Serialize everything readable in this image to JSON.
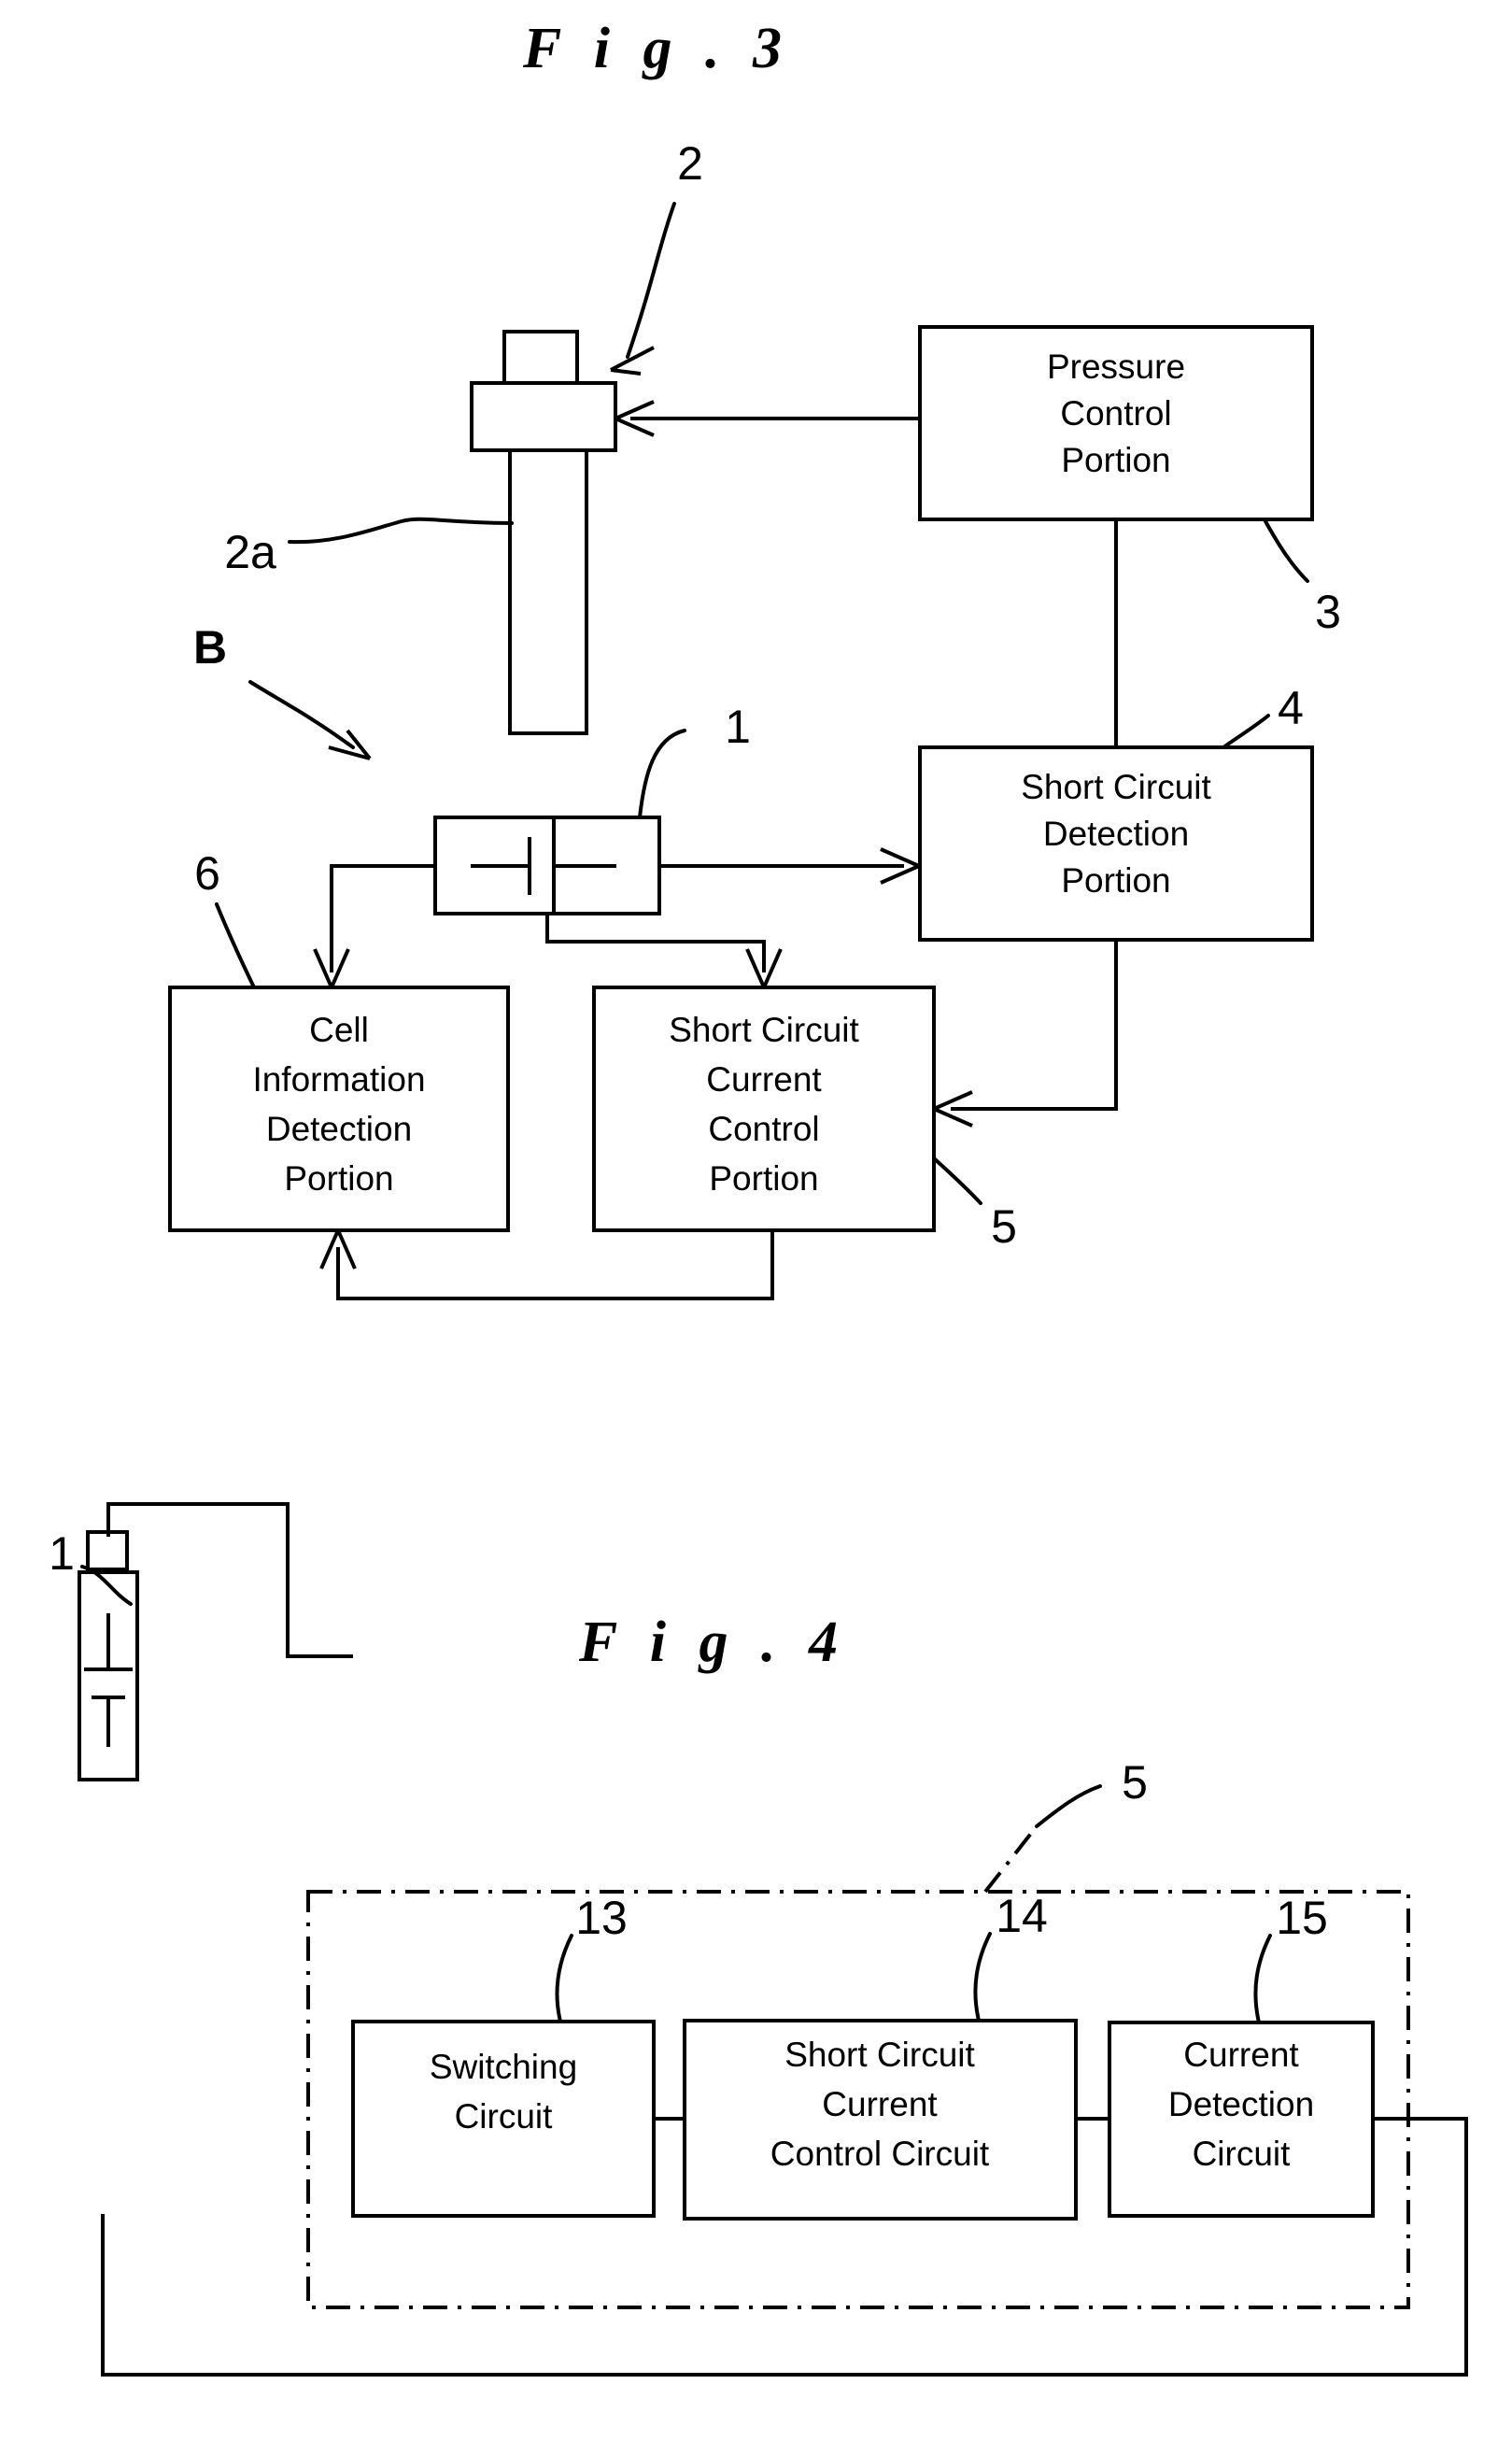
{
  "figures": [
    {
      "id": "fig3",
      "title": "F i g . 3",
      "boxes": [
        {
          "key": "pressure_control",
          "lines": [
            "Pressure",
            "Control",
            "Portion"
          ],
          "ref": "3"
        },
        {
          "key": "short_circuit_detection",
          "lines": [
            "Short Circuit",
            "Detection",
            "Portion"
          ],
          "ref": "4"
        },
        {
          "key": "cell_information_detection",
          "lines": [
            "Cell",
            "Information",
            "Detection",
            "Portion"
          ],
          "ref": "6"
        },
        {
          "key": "short_circuit_current_control",
          "lines": [
            "Short Circuit",
            "Current",
            "Control",
            "Portion"
          ],
          "ref": "5"
        }
      ],
      "refs": {
        "piston_assembly": "2",
        "piston_shaft": "2a",
        "cell": "1",
        "assembly_marker": "B",
        "pressure_control": "3",
        "short_circuit_detection": "4",
        "short_circuit_current_control": "5",
        "cell_information_detection": "6"
      }
    },
    {
      "id": "fig4",
      "title": "F i g . 4",
      "boxes": [
        {
          "key": "switching_circuit",
          "lines": [
            "Switching",
            "Circuit"
          ],
          "ref": "13"
        },
        {
          "key": "short_circuit_current_control_circuit",
          "lines": [
            "Short Circuit",
            "Current",
            "Control Circuit"
          ],
          "ref": "14"
        },
        {
          "key": "current_detection_circuit",
          "lines": [
            "Current",
            "Detection",
            "Circuit"
          ],
          "ref": "15"
        }
      ],
      "refs": {
        "cell": "1",
        "enclosure": "5",
        "switching_circuit": "13",
        "short_circuit_current_control_circuit": "14",
        "current_detection_circuit": "15"
      }
    }
  ],
  "colors": {
    "ink": "#000000",
    "paper": "#ffffff"
  }
}
